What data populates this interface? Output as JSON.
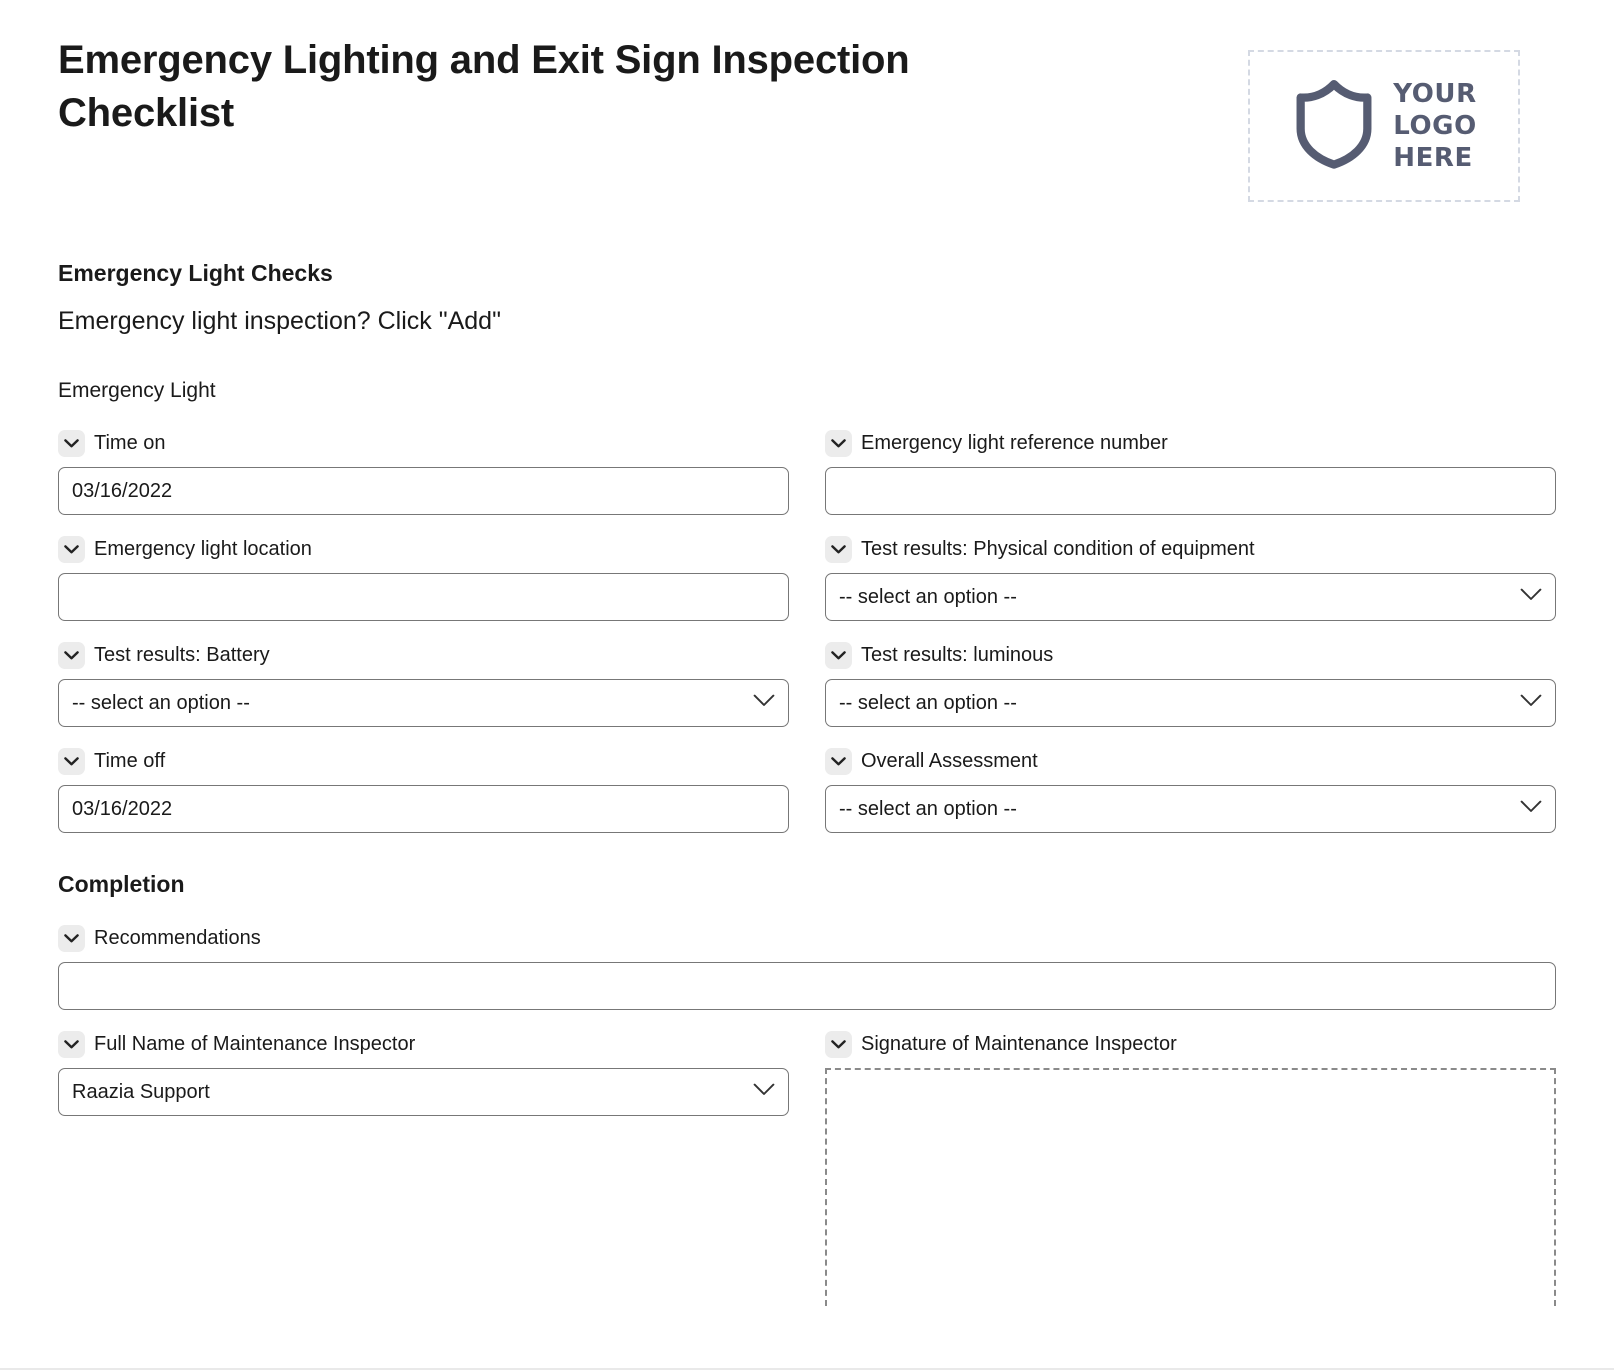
{
  "document": {
    "title": "Emergency Lighting and Exit Sign Inspection Checklist"
  },
  "logo": {
    "icon": "shield-icon",
    "line1": "YOUR",
    "line2": "LOGO",
    "line3": "HERE",
    "color": "#565c72",
    "border_color": "#d4d9e3"
  },
  "sections": [
    {
      "heading": "Emergency Light Checks",
      "subheading": "Emergency light inspection? Click \"Add\"",
      "group_label": "Emergency Light"
    },
    {
      "heading": "Completion"
    }
  ],
  "fields": {
    "time_on": {
      "label": "Time on",
      "value": "03/16/2022",
      "placeholder": "",
      "type": "text"
    },
    "reference_number": {
      "label": "Emergency light reference number",
      "value": "",
      "placeholder": "",
      "type": "text"
    },
    "light_location": {
      "label": "Emergency light location",
      "value": "",
      "placeholder": "",
      "type": "text"
    },
    "physical_condition": {
      "label": "Test results: Physical condition of equipment",
      "value": "-- select an option --",
      "type": "select"
    },
    "battery": {
      "label": "Test results: Battery",
      "value": "-- select an option --",
      "type": "select"
    },
    "luminous": {
      "label": "Test results: luminous",
      "value": "-- select an option --",
      "type": "select"
    },
    "time_off": {
      "label": "Time off",
      "value": "03/16/2022",
      "placeholder": "",
      "type": "text"
    },
    "overall_assessment": {
      "label": "Overall Assessment",
      "value": "-- select an option --",
      "type": "select"
    },
    "recommendations": {
      "label": "Recommendations",
      "value": "",
      "placeholder": "",
      "type": "text"
    },
    "inspector_name": {
      "label": "Full Name of Maintenance Inspector",
      "value": "Raazia Support",
      "type": "select"
    },
    "inspector_signature": {
      "label": "Signature of Maintenance Inspector",
      "value": "",
      "type": "signature"
    }
  },
  "icons": {
    "field_chevron": "chevron-down-icon",
    "select_chevron": "chevron-down-icon"
  }
}
